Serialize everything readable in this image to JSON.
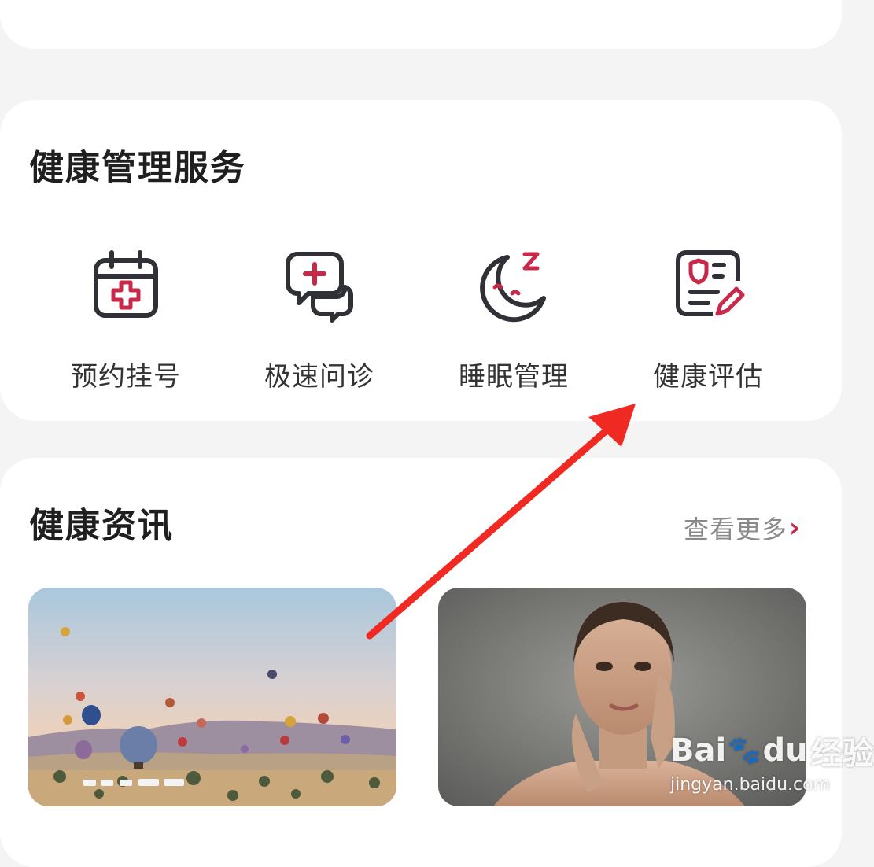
{
  "service_section": {
    "title": "健康管理服务",
    "items": [
      {
        "label": "预约挂号",
        "icon": "calendar-plus-icon"
      },
      {
        "label": "极速问诊",
        "icon": "chat-plus-icon"
      },
      {
        "label": "睡眠管理",
        "icon": "moon-sleep-icon"
      },
      {
        "label": "健康评估",
        "icon": "assessment-shield-icon"
      }
    ]
  },
  "news_section": {
    "title": "健康资讯",
    "more_label": "查看更多",
    "more_icon": "chevron-right-icon",
    "cards": [
      {
        "image": "hot-air-balloons-image"
      },
      {
        "image": "woman-portrait-image"
      }
    ]
  },
  "watermark": {
    "brand": "Bai",
    "brand_du": "du",
    "brand_cn": "经验",
    "url": "jingyan.baidu.com"
  },
  "colors": {
    "accent": "#c8294a",
    "icon_dark": "#2f3136",
    "arrow": "#f02a22",
    "background": "#f4f4f4"
  }
}
